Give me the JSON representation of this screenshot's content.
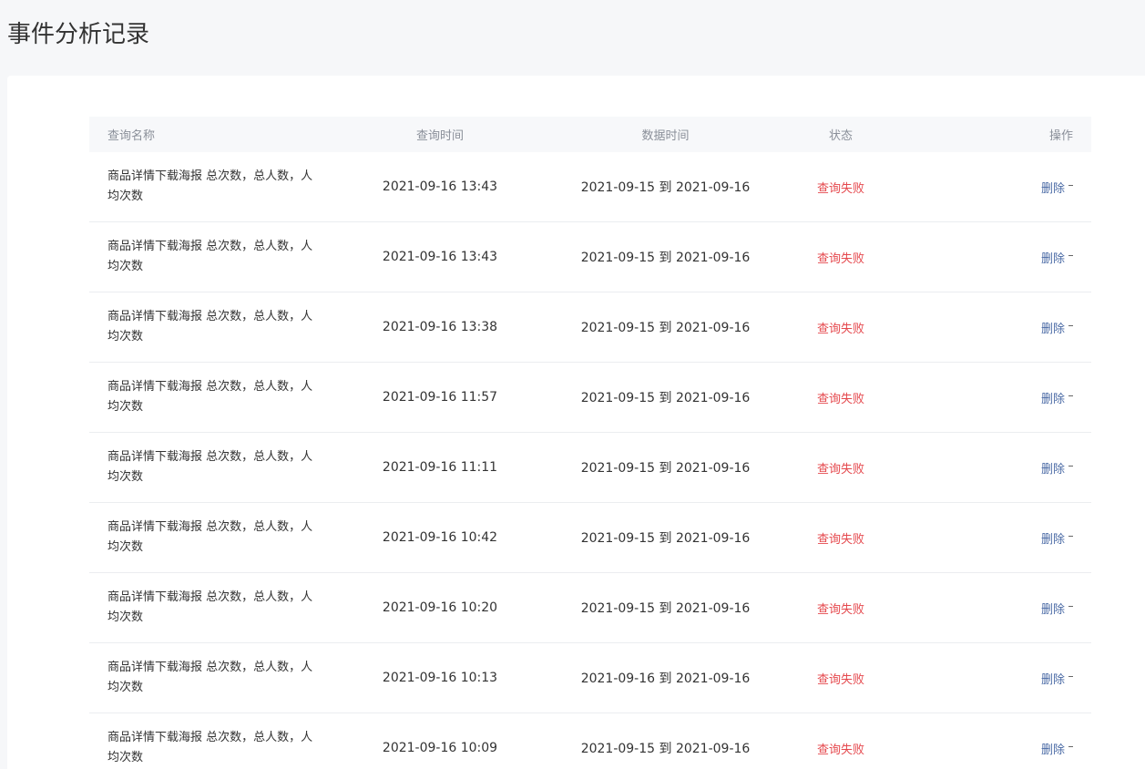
{
  "page": {
    "title": "事件分析记录"
  },
  "table": {
    "headers": {
      "name": "查询名称",
      "query_time": "查询时间",
      "data_time": "数据时间",
      "status": "状态",
      "operation": "操作"
    },
    "rows": [
      {
        "name": "商品详情下载海报 总次数，总人数，人均次数",
        "query_time": "2021-09-16 13:43",
        "data_time": "2021-09-15 到 2021-09-16",
        "status": "查询失败",
        "action": "删除"
      },
      {
        "name": "商品详情下载海报 总次数，总人数，人均次数",
        "query_time": "2021-09-16 13:43",
        "data_time": "2021-09-15 到 2021-09-16",
        "status": "查询失败",
        "action": "删除"
      },
      {
        "name": "商品详情下载海报 总次数，总人数，人均次数",
        "query_time": "2021-09-16 13:38",
        "data_time": "2021-09-15 到 2021-09-16",
        "status": "查询失败",
        "action": "删除"
      },
      {
        "name": "商品详情下载海报 总次数，总人数，人均次数",
        "query_time": "2021-09-16 11:57",
        "data_time": "2021-09-15 到 2021-09-16",
        "status": "查询失败",
        "action": "删除"
      },
      {
        "name": "商品详情下载海报 总次数，总人数，人均次数",
        "query_time": "2021-09-16 11:11",
        "data_time": "2021-09-15 到 2021-09-16",
        "status": "查询失败",
        "action": "删除"
      },
      {
        "name": "商品详情下载海报 总次数，总人数，人均次数",
        "query_time": "2021-09-16 10:42",
        "data_time": "2021-09-15 到 2021-09-16",
        "status": "查询失败",
        "action": "删除"
      },
      {
        "name": "商品详情下载海报 总次数，总人数，人均次数",
        "query_time": "2021-09-16 10:20",
        "data_time": "2021-09-15 到 2021-09-16",
        "status": "查询失败",
        "action": "删除"
      },
      {
        "name": "商品详情下载海报 总次数，总人数，人均次数",
        "query_time": "2021-09-16 10:13",
        "data_time": "2021-09-16 到 2021-09-16",
        "status": "查询失败",
        "action": "删除"
      },
      {
        "name": "商品详情下载海报 总次数，总人数，人均次数",
        "query_time": "2021-09-16 10:09",
        "data_time": "2021-09-15 到 2021-09-16",
        "status": "查询失败",
        "action": "删除"
      }
    ]
  },
  "colors": {
    "status_fail": "#e5484d",
    "link": "#4a6aa5",
    "header_bg": "#f7f8fa",
    "page_bg": "#f6f7f9"
  },
  "icons": {
    "more": "dash-icon"
  }
}
